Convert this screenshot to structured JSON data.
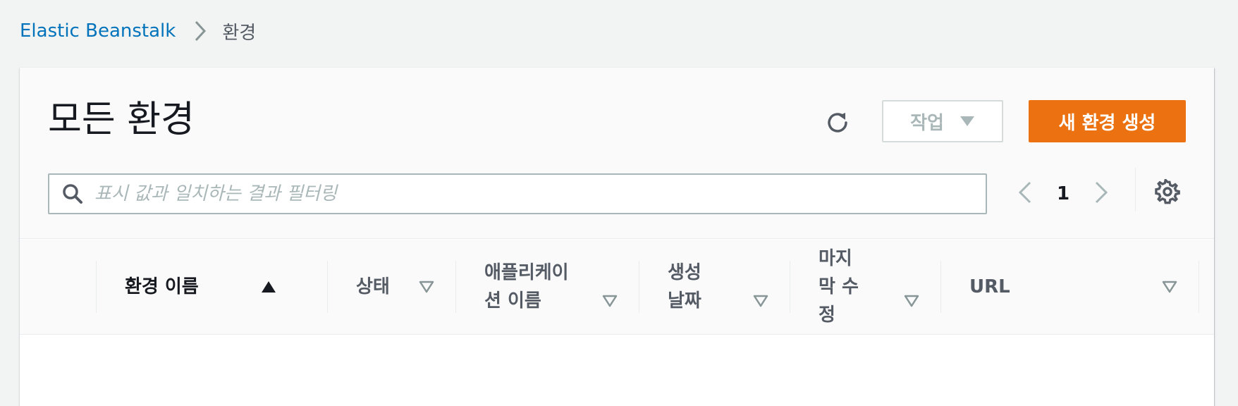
{
  "breadcrumb": {
    "service": "Elastic Beanstalk",
    "current": "환경"
  },
  "header": {
    "title": "모든 환경",
    "actions_label": "작업",
    "create_label": "새 환경 생성"
  },
  "search": {
    "placeholder": "표시 값과 일치하는 결과 필터링",
    "value": ""
  },
  "pagination": {
    "current_page": "1"
  },
  "table": {
    "columns": [
      {
        "label": "환경 이름",
        "sort": "ascending"
      },
      {
        "label": "상태",
        "sort": "none"
      },
      {
        "label": "애플리케이션 이름",
        "sort": "none"
      },
      {
        "label": "생성 날짜",
        "sort": "none"
      },
      {
        "label": "마지막 수정",
        "sort": "none"
      },
      {
        "label": "URL",
        "sort": "none"
      }
    ]
  },
  "colors": {
    "primary_button": "#ec7211",
    "link": "#0073bb",
    "background": "#f2f3f3"
  },
  "icons": [
    "chevron-right-icon",
    "refresh-icon",
    "caret-down-icon",
    "search-icon",
    "chevron-left-icon",
    "gear-icon",
    "sort-ascending-icon",
    "sort-none-icon"
  ]
}
